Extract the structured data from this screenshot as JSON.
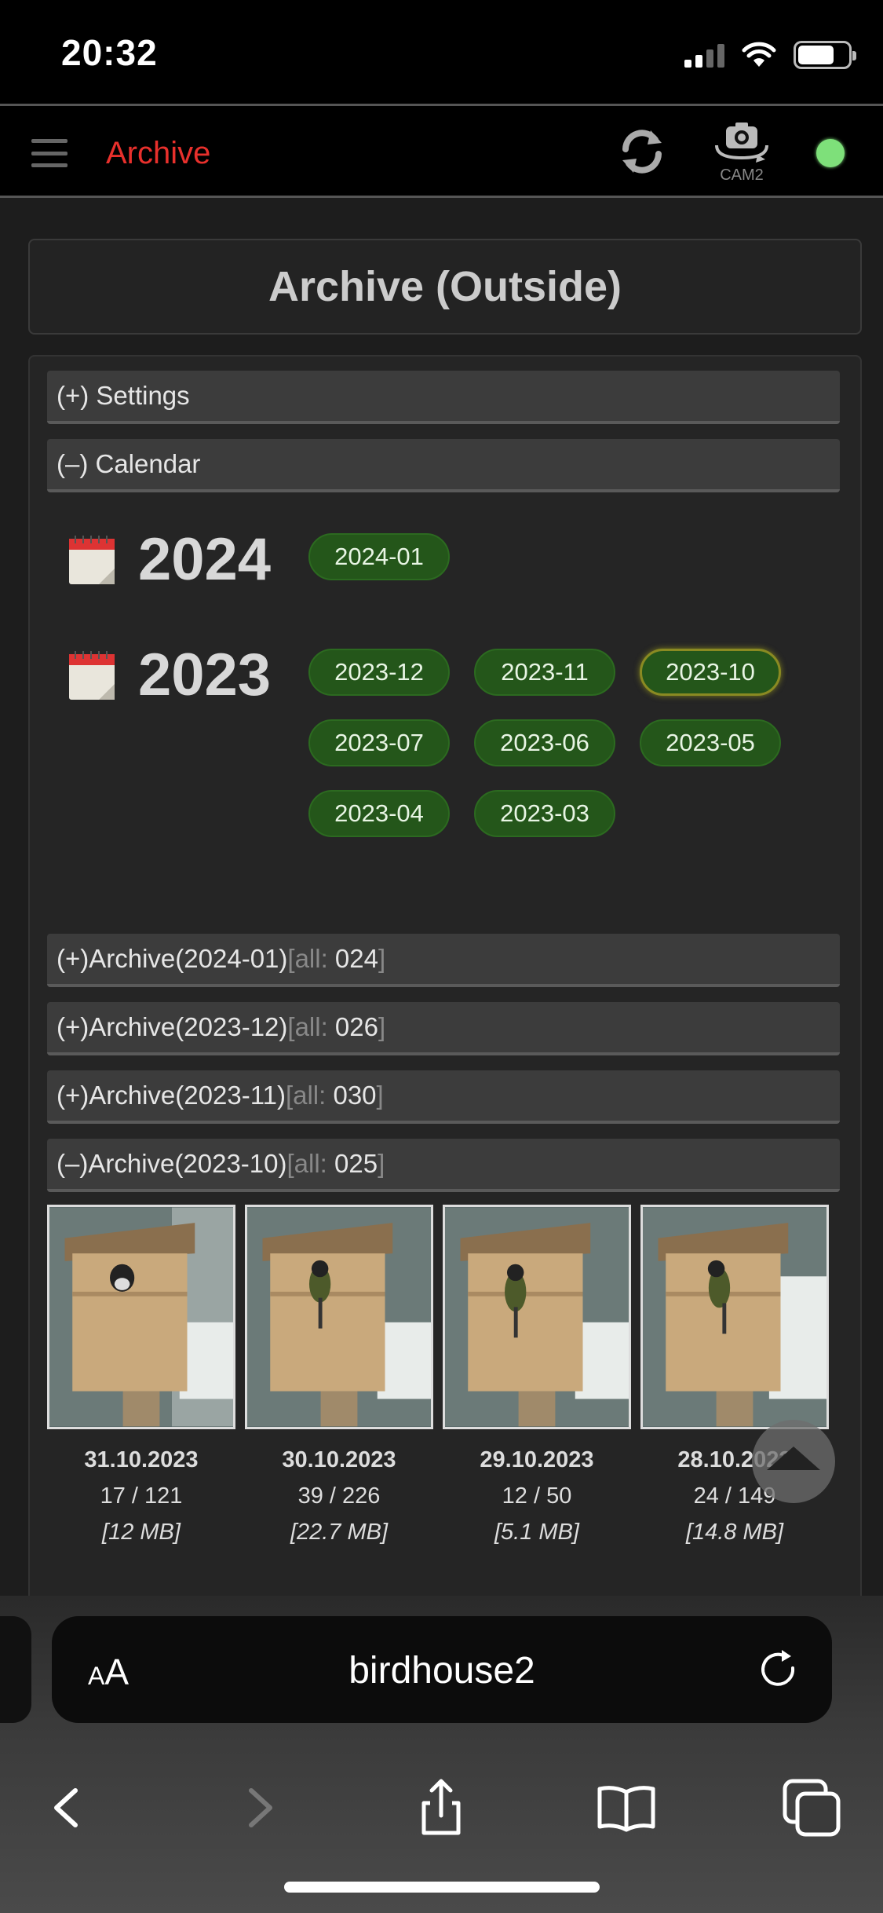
{
  "status_bar": {
    "time": "20:32",
    "icons": [
      "signal-icon",
      "wifi-icon",
      "battery-icon"
    ]
  },
  "header": {
    "title": "Archive",
    "title_color": "#e8302c",
    "reload_icon": "reload-icon",
    "cam_label": "CAM2",
    "status_color": "#7ee07a"
  },
  "page": {
    "title": "Archive (Outside)",
    "settings_label": "(+) Settings",
    "calendar_label": "(–) Calendar"
  },
  "calendar": {
    "years": [
      {
        "year": "2024",
        "months": [
          "2024-01"
        ]
      },
      {
        "year": "2023",
        "months": [
          "2023-12",
          "2023-11",
          "2023-10",
          "2023-07",
          "2023-06",
          "2023-05",
          "2023-04",
          "2023-03"
        ]
      }
    ],
    "active_month": "2023-10",
    "button_color": "#24561a"
  },
  "archives": [
    {
      "toggle": "(+)",
      "label": "Archive",
      "month": "(2024-01)",
      "all_label": "all:",
      "count": "024"
    },
    {
      "toggle": "(+)",
      "label": "Archive",
      "month": "(2023-12)",
      "all_label": "all:",
      "count": "026"
    },
    {
      "toggle": "(+)",
      "label": "Archive",
      "month": "(2023-11)",
      "all_label": "all:",
      "count": "030"
    },
    {
      "toggle": "(–)",
      "label": "Archive",
      "month": "(2023-10)",
      "all_label": "all:",
      "count": "025"
    }
  ],
  "days": [
    {
      "date": "31.10.2023",
      "counts": "17 / 121",
      "size": "[12 MB]"
    },
    {
      "date": "30.10.2023",
      "counts": "39 / 226",
      "size": "[22.7 MB]"
    },
    {
      "date": "29.10.2023",
      "counts": "12 / 50",
      "size": "[5.1 MB]"
    },
    {
      "date": "28.10.2023",
      "counts": "24 / 149",
      "size": "[14.8 MB]"
    }
  ],
  "safari": {
    "aa_label": "AA",
    "url": "birdhouse2",
    "toolbar_icons": [
      "back-icon",
      "forward-icon",
      "share-icon",
      "bookmarks-icon",
      "tabs-icon"
    ]
  }
}
